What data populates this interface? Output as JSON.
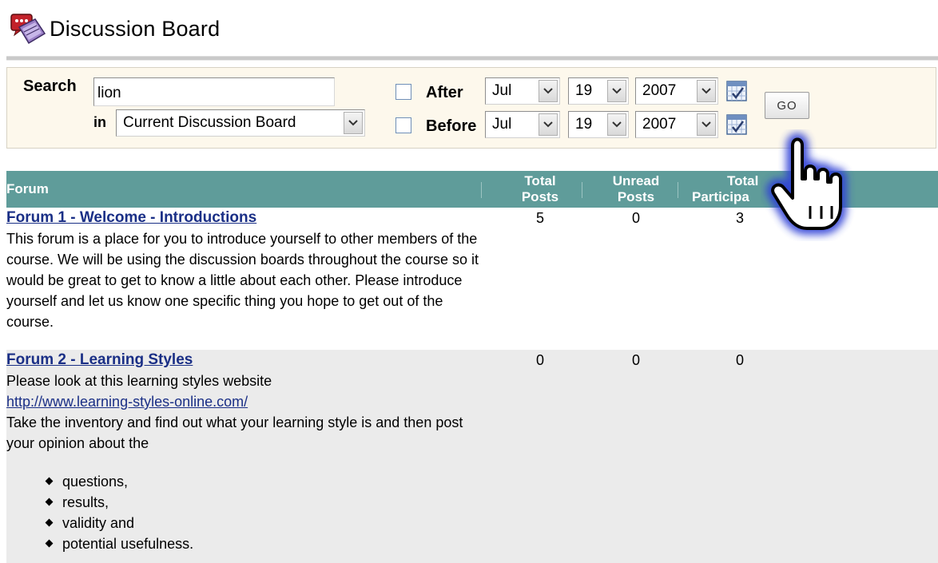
{
  "header": {
    "title": "Discussion Board",
    "icon": "discussion-board-icon"
  },
  "search": {
    "label": "Search",
    "query": "lion",
    "in_label": "in",
    "scope": "Current Discussion Board",
    "after_label": "After",
    "before_label": "Before",
    "after_checked": false,
    "before_checked": false,
    "after_date": {
      "month": "Jul",
      "day": "19",
      "year": "2007"
    },
    "before_date": {
      "month": "Jul",
      "day": "19",
      "year": "2007"
    },
    "go_label": "GO"
  },
  "table": {
    "columns": {
      "forum": "Forum",
      "total_posts": [
        "Total",
        "Posts"
      ],
      "unread_posts": [
        "Unread",
        "Posts"
      ],
      "total_participants": [
        "Total",
        "Participa"
      ]
    },
    "rows": [
      {
        "title": "Forum 1 - Welcome - Introductions",
        "description": "This forum is a place for you to introduce yourself to other members of the course. We will be using the discussion boards throughout the course so it would be great to get to know a little about each other. Please introduce yourself and let us know one specific thing you hope to get out of the course.",
        "total_posts": "5",
        "unread_posts": "0",
        "total_participants": "3"
      },
      {
        "title": "Forum 2 - Learning Styles",
        "description_intro": "Please look at this learning styles website",
        "url": "http://www.learning-styles-online.com/",
        "description_after": "Take the inventory and find out what your learning style is and then post your opinion about the",
        "bullets": [
          "questions,",
          "results,",
          "validity and",
          "potential usefulness."
        ],
        "total_posts": "0",
        "unread_posts": "0",
        "total_participants": "0"
      }
    ]
  },
  "colors": {
    "header_bar": "#5f9c9a",
    "search_panel": "#fdf8ec",
    "link": "#1a2f86",
    "row_alt": "#ebebeb"
  },
  "overlay": {
    "cursor": "hand-pointer-icon"
  }
}
